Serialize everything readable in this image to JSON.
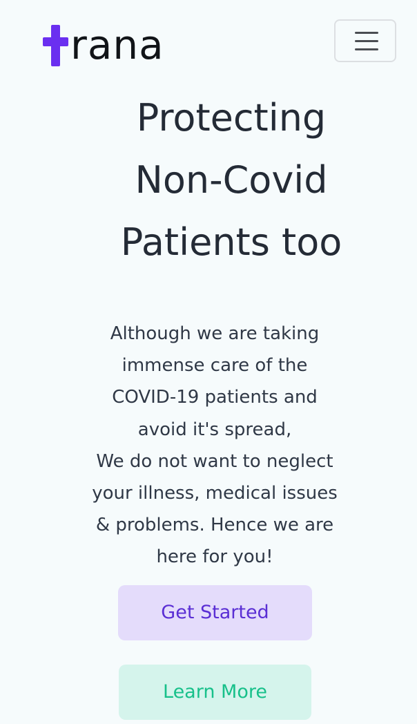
{
  "navbar": {
    "brand_text": "rana",
    "menu_icon": "hamburger-icon",
    "brand_color": "#6a2ff0"
  },
  "hero": {
    "title_lines": [
      "Protecting",
      "Non-Covid",
      "Patients too"
    ],
    "description_lines": [
      "Although we are taking",
      "immense care of the",
      "COVID-19 patients and",
      "avoid it's spread,",
      "We do not want to neglect",
      "your illness, medical issues",
      "& problems. Hence we are",
      "here for you!"
    ]
  },
  "actions": {
    "get_started_label": "Get Started",
    "learn_more_label": "Learn More"
  },
  "colors": {
    "background": "#f6fbfc",
    "primary_bg": "#e4dcfb",
    "primary_text": "#5a2ed4",
    "secondary_bg": "#d5f4ec",
    "secondary_text": "#17c08a"
  }
}
